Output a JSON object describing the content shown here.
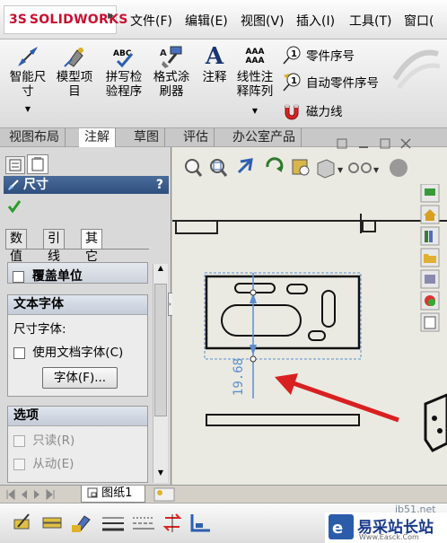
{
  "app": {
    "brand": "SOLIDWORKS",
    "logo_mark": "3S"
  },
  "menu": [
    "文件(F)",
    "编辑(E)",
    "视图(V)",
    "插入(I)",
    "工具(T)",
    "窗口("
  ],
  "ribbon": {
    "buttons": [
      {
        "label": "智能尺\n寸",
        "icon": "smart-dimension-icon"
      },
      {
        "label": "模型项\n目",
        "icon": "model-items-icon"
      },
      {
        "label": "拼写检\n验程序",
        "icon": "spell-check-icon",
        "icon_text": "ABC"
      },
      {
        "label": "格式涂\n刷器",
        "icon": "format-painter-icon"
      },
      {
        "label": "注释",
        "icon": "note-icon",
        "icon_text": "A"
      },
      {
        "label": "线性注\n释阵列",
        "icon": "linear-note-pattern-icon",
        "icon_text": "AAA\nAAA"
      }
    ],
    "small": [
      {
        "label": "零件序号",
        "icon": "balloon-icon",
        "icon_text": "1"
      },
      {
        "label": "自动零件序号",
        "icon": "auto-balloon-icon",
        "icon_text": "1"
      },
      {
        "label": "磁力线",
        "icon": "magnetic-line-icon"
      }
    ]
  },
  "tabs": [
    "视图布局",
    "注解",
    "草图",
    "评估",
    "办公室产品"
  ],
  "active_tab": 1,
  "pm": {
    "title": "尺寸",
    "help": "?",
    "subtabs": [
      "数值",
      "引线",
      "其它"
    ],
    "override": "覆盖单位",
    "text_font": {
      "header": "文本字体",
      "label": "尺寸字体:",
      "use_doc_font": "使用文档字体(C)",
      "font_button": "字体(F)..."
    },
    "options": {
      "header": "选项",
      "readonly": "只读(R)",
      "driven": "从动(E)"
    }
  },
  "drawing": {
    "dimension_text": "19.68"
  },
  "sheet": {
    "tab": "图纸1"
  },
  "watermark": {
    "url": "jb51.net",
    "site": "易采站长站",
    "sub": "Www.Easck.Com"
  },
  "colors": {
    "accent": "#c8102e",
    "title": "#2f4f7e",
    "arrow": "#d92020",
    "dim": "#5b8fcf"
  }
}
